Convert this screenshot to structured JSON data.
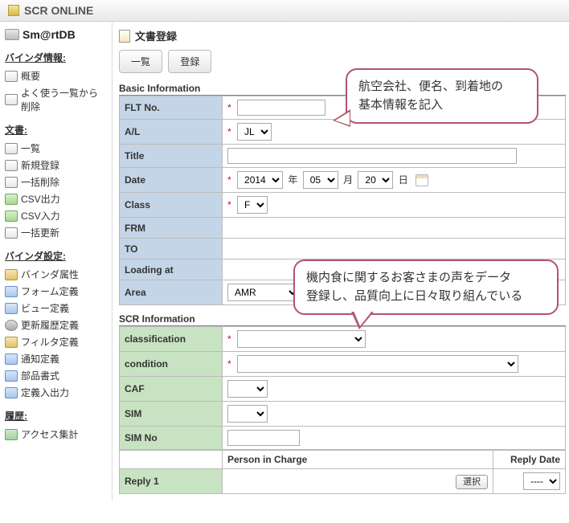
{
  "app_title": "SCR ONLINE",
  "brand": "Sm@rtDB",
  "page_title": "文書登録",
  "toolbar": {
    "list": "一覧",
    "register": "登録"
  },
  "sidebar": {
    "groups": [
      {
        "heading": "バインダ情報:",
        "items": [
          {
            "id": "overview",
            "label": "概要"
          },
          {
            "id": "del-from-recent",
            "label": "よく使う一覧から削除"
          }
        ]
      },
      {
        "heading": "文書:",
        "items": [
          {
            "id": "list",
            "label": "一覧"
          },
          {
            "id": "new",
            "label": "新規登録"
          },
          {
            "id": "bulk-delete",
            "label": "一括削除"
          },
          {
            "id": "csv-out",
            "label": "CSV出力"
          },
          {
            "id": "csv-in",
            "label": "CSV入力"
          },
          {
            "id": "bulk-update",
            "label": "一括更新"
          }
        ]
      },
      {
        "heading": "バインダ設定:",
        "items": [
          {
            "id": "attr",
            "label": "バインダ属性"
          },
          {
            "id": "form-def",
            "label": "フォーム定義"
          },
          {
            "id": "view-def",
            "label": "ビュー定義"
          },
          {
            "id": "hist-def",
            "label": "更新履歴定義"
          },
          {
            "id": "filter-def",
            "label": "フィルタ定義"
          },
          {
            "id": "notify-def",
            "label": "通知定義"
          },
          {
            "id": "part-fmt",
            "label": "部品書式"
          },
          {
            "id": "def-io",
            "label": "定義入出力"
          }
        ]
      },
      {
        "heading": "履歴:",
        "items": [
          {
            "id": "access-agg",
            "label": "アクセス集計"
          }
        ]
      }
    ]
  },
  "basic": {
    "section": "Basic Information",
    "rows": {
      "flt_no": {
        "label": "FLT No.",
        "required": true,
        "value": ""
      },
      "al": {
        "label": "A/L",
        "required": true,
        "value": "JL"
      },
      "title": {
        "label": "Title",
        "required": false,
        "value": ""
      },
      "date": {
        "label": "Date",
        "required": true,
        "year": "2014",
        "y_suffix": "年",
        "month": "05",
        "m_suffix": "月",
        "day": "20",
        "d_suffix": "日"
      },
      "class": {
        "label": "Class",
        "required": true,
        "value": "F"
      },
      "frm": {
        "label": "FRM"
      },
      "to": {
        "label": "TO"
      },
      "loading": {
        "label": "Loading at"
      },
      "area": {
        "label": "Area",
        "required": false,
        "value": "AMR"
      }
    }
  },
  "scr": {
    "section": "SCR Information",
    "rows": {
      "classification": {
        "label": "classification",
        "required": true,
        "value": ""
      },
      "condition": {
        "label": "condition",
        "required": true,
        "value": ""
      },
      "caf": {
        "label": "CAF",
        "value": ""
      },
      "sim": {
        "label": "SIM",
        "value": ""
      },
      "sim_no": {
        "label": "SIM No",
        "value": ""
      }
    }
  },
  "reply": {
    "person_header": "Person in Charge",
    "date_header": "Reply Date",
    "row1_label": "Reply 1",
    "select_btn": "選択",
    "date_value": "----"
  },
  "callouts": {
    "c1a": "航空会社、便名、到着地の",
    "c1b": "基本情報を記入",
    "c2a": "機内食に関するお客さまの声をデータ",
    "c2b": "登録し、品質向上に日々取り組んでいる"
  }
}
